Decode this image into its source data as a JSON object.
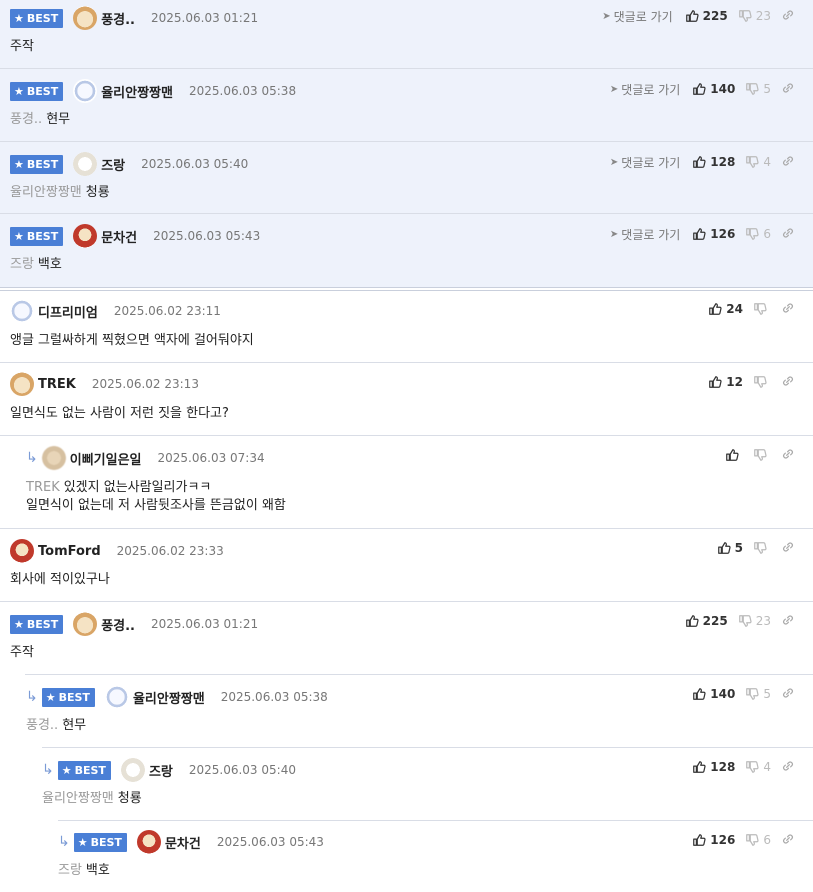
{
  "best_label": "BEST",
  "go_label": "댓글로 가기",
  "best_comments": [
    {
      "author": "풍경..",
      "date": "2025.06.03 01:21",
      "quote": "",
      "text": "주작",
      "up": "225",
      "down": "23",
      "avatar": "puppy"
    },
    {
      "author": "율리안짱짱맨",
      "date": "2025.06.03 05:38",
      "quote": "풍경..",
      "text": "현무",
      "up": "140",
      "down": "5",
      "avatar": "bear"
    },
    {
      "author": "즈랑",
      "date": "2025.06.03 05:40",
      "quote": "율리안짱짱맨",
      "text": "청룡",
      "up": "128",
      "down": "4",
      "avatar": "white-dog"
    },
    {
      "author": "문차건",
      "date": "2025.06.03 05:43",
      "quote": "즈랑",
      "text": "백호",
      "up": "126",
      "down": "6",
      "avatar": "red-puppy"
    }
  ],
  "comments": [
    {
      "author": "디프리미엄",
      "date": "2025.06.02 23:11",
      "quote": "",
      "text": "앵글 그럴싸하게 찍혔으면 액자에 걸어둬야지",
      "up": "24",
      "down": "",
      "avatar": "bear"
    },
    {
      "author": "TREK",
      "date": "2025.06.02 23:13",
      "quote": "",
      "text": "일면식도 없는 사람이 저런 짓을 한다고?",
      "up": "12",
      "down": "",
      "avatar": "puppy"
    },
    {
      "author": "이삐기일은일",
      "date": "2025.06.03 07:34",
      "quote": "TREK",
      "text": "있겠지 없는사람일리가ㅋㅋ",
      "text2": "일면식이 없는데 저 사람뒷조사를 뜬금없이 왜함",
      "up": "",
      "down": "",
      "avatar": "blur-puppy"
    },
    {
      "author": "TomFord",
      "date": "2025.06.02 23:33",
      "quote": "",
      "text": "회사에 적이있구나",
      "up": "5",
      "down": "",
      "avatar": "red-puppy"
    },
    {
      "author": "풍경..",
      "date": "2025.06.03 01:21",
      "quote": "",
      "text": "주작",
      "up": "225",
      "down": "23",
      "avatar": "puppy"
    },
    {
      "author": "율리안짱짱맨",
      "date": "2025.06.03 05:38",
      "quote": "풍경..",
      "text": "현무",
      "up": "140",
      "down": "5",
      "avatar": "bear"
    },
    {
      "author": "즈랑",
      "date": "2025.06.03 05:40",
      "quote": "율리안짱짱맨",
      "text": "청룡",
      "up": "128",
      "down": "4",
      "avatar": "white-dog"
    },
    {
      "author": "문차건",
      "date": "2025.06.03 05:43",
      "quote": "즈랑",
      "text": "백호",
      "up": "126",
      "down": "6",
      "avatar": "red-puppy"
    }
  ],
  "colors": {
    "best_bg": "#eef2fb",
    "badge": "#4a7fd6",
    "reply_arrow": "#7b9bd6"
  }
}
